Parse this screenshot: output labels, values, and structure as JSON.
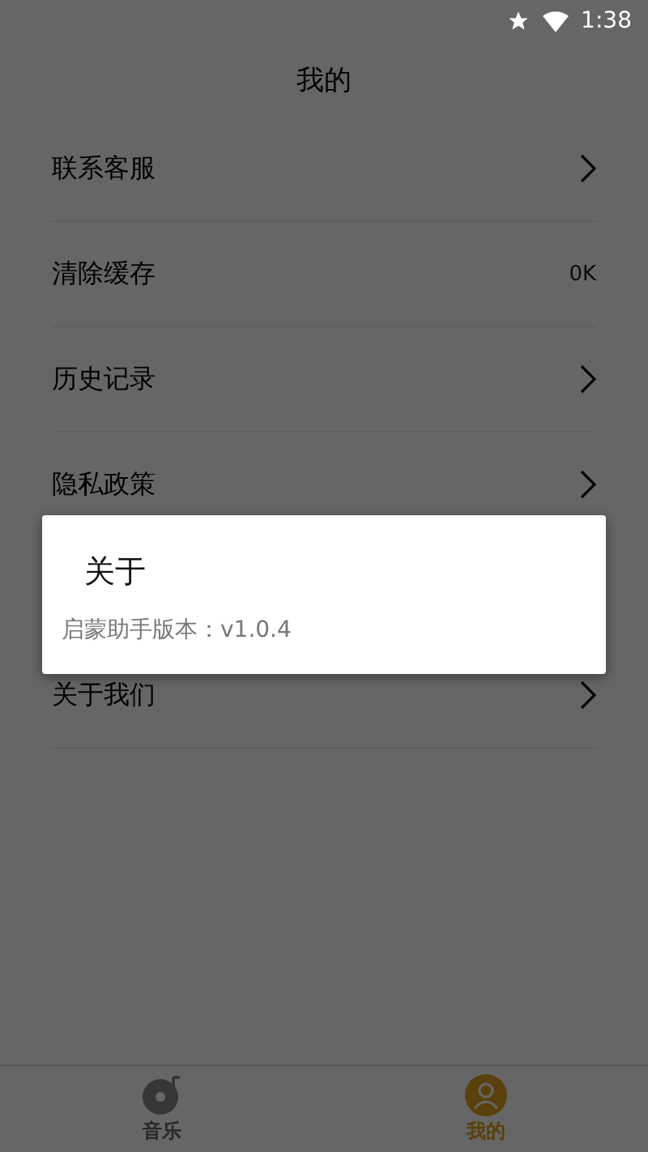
{
  "status_bar": {
    "time": "1:38"
  },
  "header": {
    "title": "我的"
  },
  "menu": [
    {
      "kind": "link",
      "label": "联系客服"
    },
    {
      "kind": "value",
      "label": "清除缓存",
      "value": "0K"
    },
    {
      "kind": "link",
      "label": "历史记录"
    },
    {
      "kind": "link",
      "label": "隐私政策"
    },
    {
      "kind": "hidden"
    },
    {
      "kind": "link",
      "label": "关于我们"
    }
  ],
  "dialog": {
    "title": "关于",
    "message": "启蒙助手版本：v1.0.4"
  },
  "bottom_nav": [
    {
      "kind": "music",
      "label": "音乐",
      "selected": false
    },
    {
      "kind": "profile",
      "label": "我的",
      "selected": true
    }
  ]
}
